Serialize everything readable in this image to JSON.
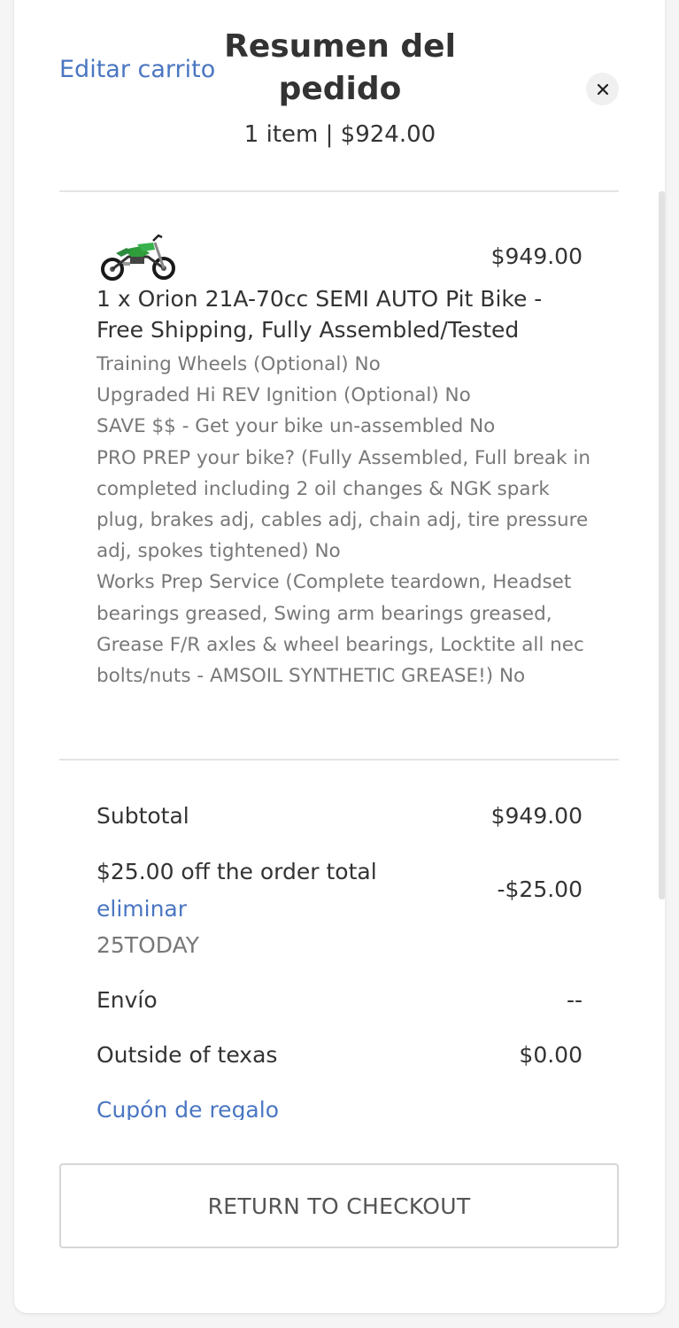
{
  "header": {
    "edit_cart_label": "Editar carrito",
    "title": "Resumen del pedido",
    "item_count": "1 item",
    "separator": "|",
    "header_total": "$924.00",
    "close_glyph": "✕"
  },
  "item": {
    "thumbnail_icon": "pit-bike-photo",
    "price": "$949.00",
    "name": "1 x Orion 21A-70cc SEMI AUTO Pit Bike - Free Shipping, Fully Assembled/Tested",
    "options": [
      "Training Wheels (Optional) No",
      "Upgraded Hi REV Ignition (Optional) No",
      "SAVE $$ - Get your bike un-assembled No",
      "PRO PREP your bike? (Fully Assembled, Full break in completed including 2 oil changes & NGK spark plug, brakes adj, cables adj, chain adj, tire pressure adj, spokes tightened) No",
      "Works Prep Service (Complete teardown, Headset bearings greased, Swing arm bearings greased, Grease F/R axles & wheel bearings, Locktite all nec bolts/nuts - AMSOIL SYNTHETIC GREASE!) No"
    ]
  },
  "summary": {
    "subtotal_label": "Subtotal",
    "subtotal_value": "$949.00",
    "discount_label": "$25.00 off the order total",
    "discount_remove": "eliminar",
    "discount_code": "25TODAY",
    "discount_value": "-$25.00",
    "shipping_label": "Envío",
    "shipping_value": "--",
    "tax_label": "Outside of texas",
    "tax_value": "$0.00",
    "gift_coupon_label": "Cupón de regalo"
  },
  "actions": {
    "return_label": "RETURN TO CHECKOUT"
  },
  "colors": {
    "link": "#4a76c2",
    "text": "#333333",
    "muted": "#787878",
    "divider": "#e4e4e4"
  }
}
